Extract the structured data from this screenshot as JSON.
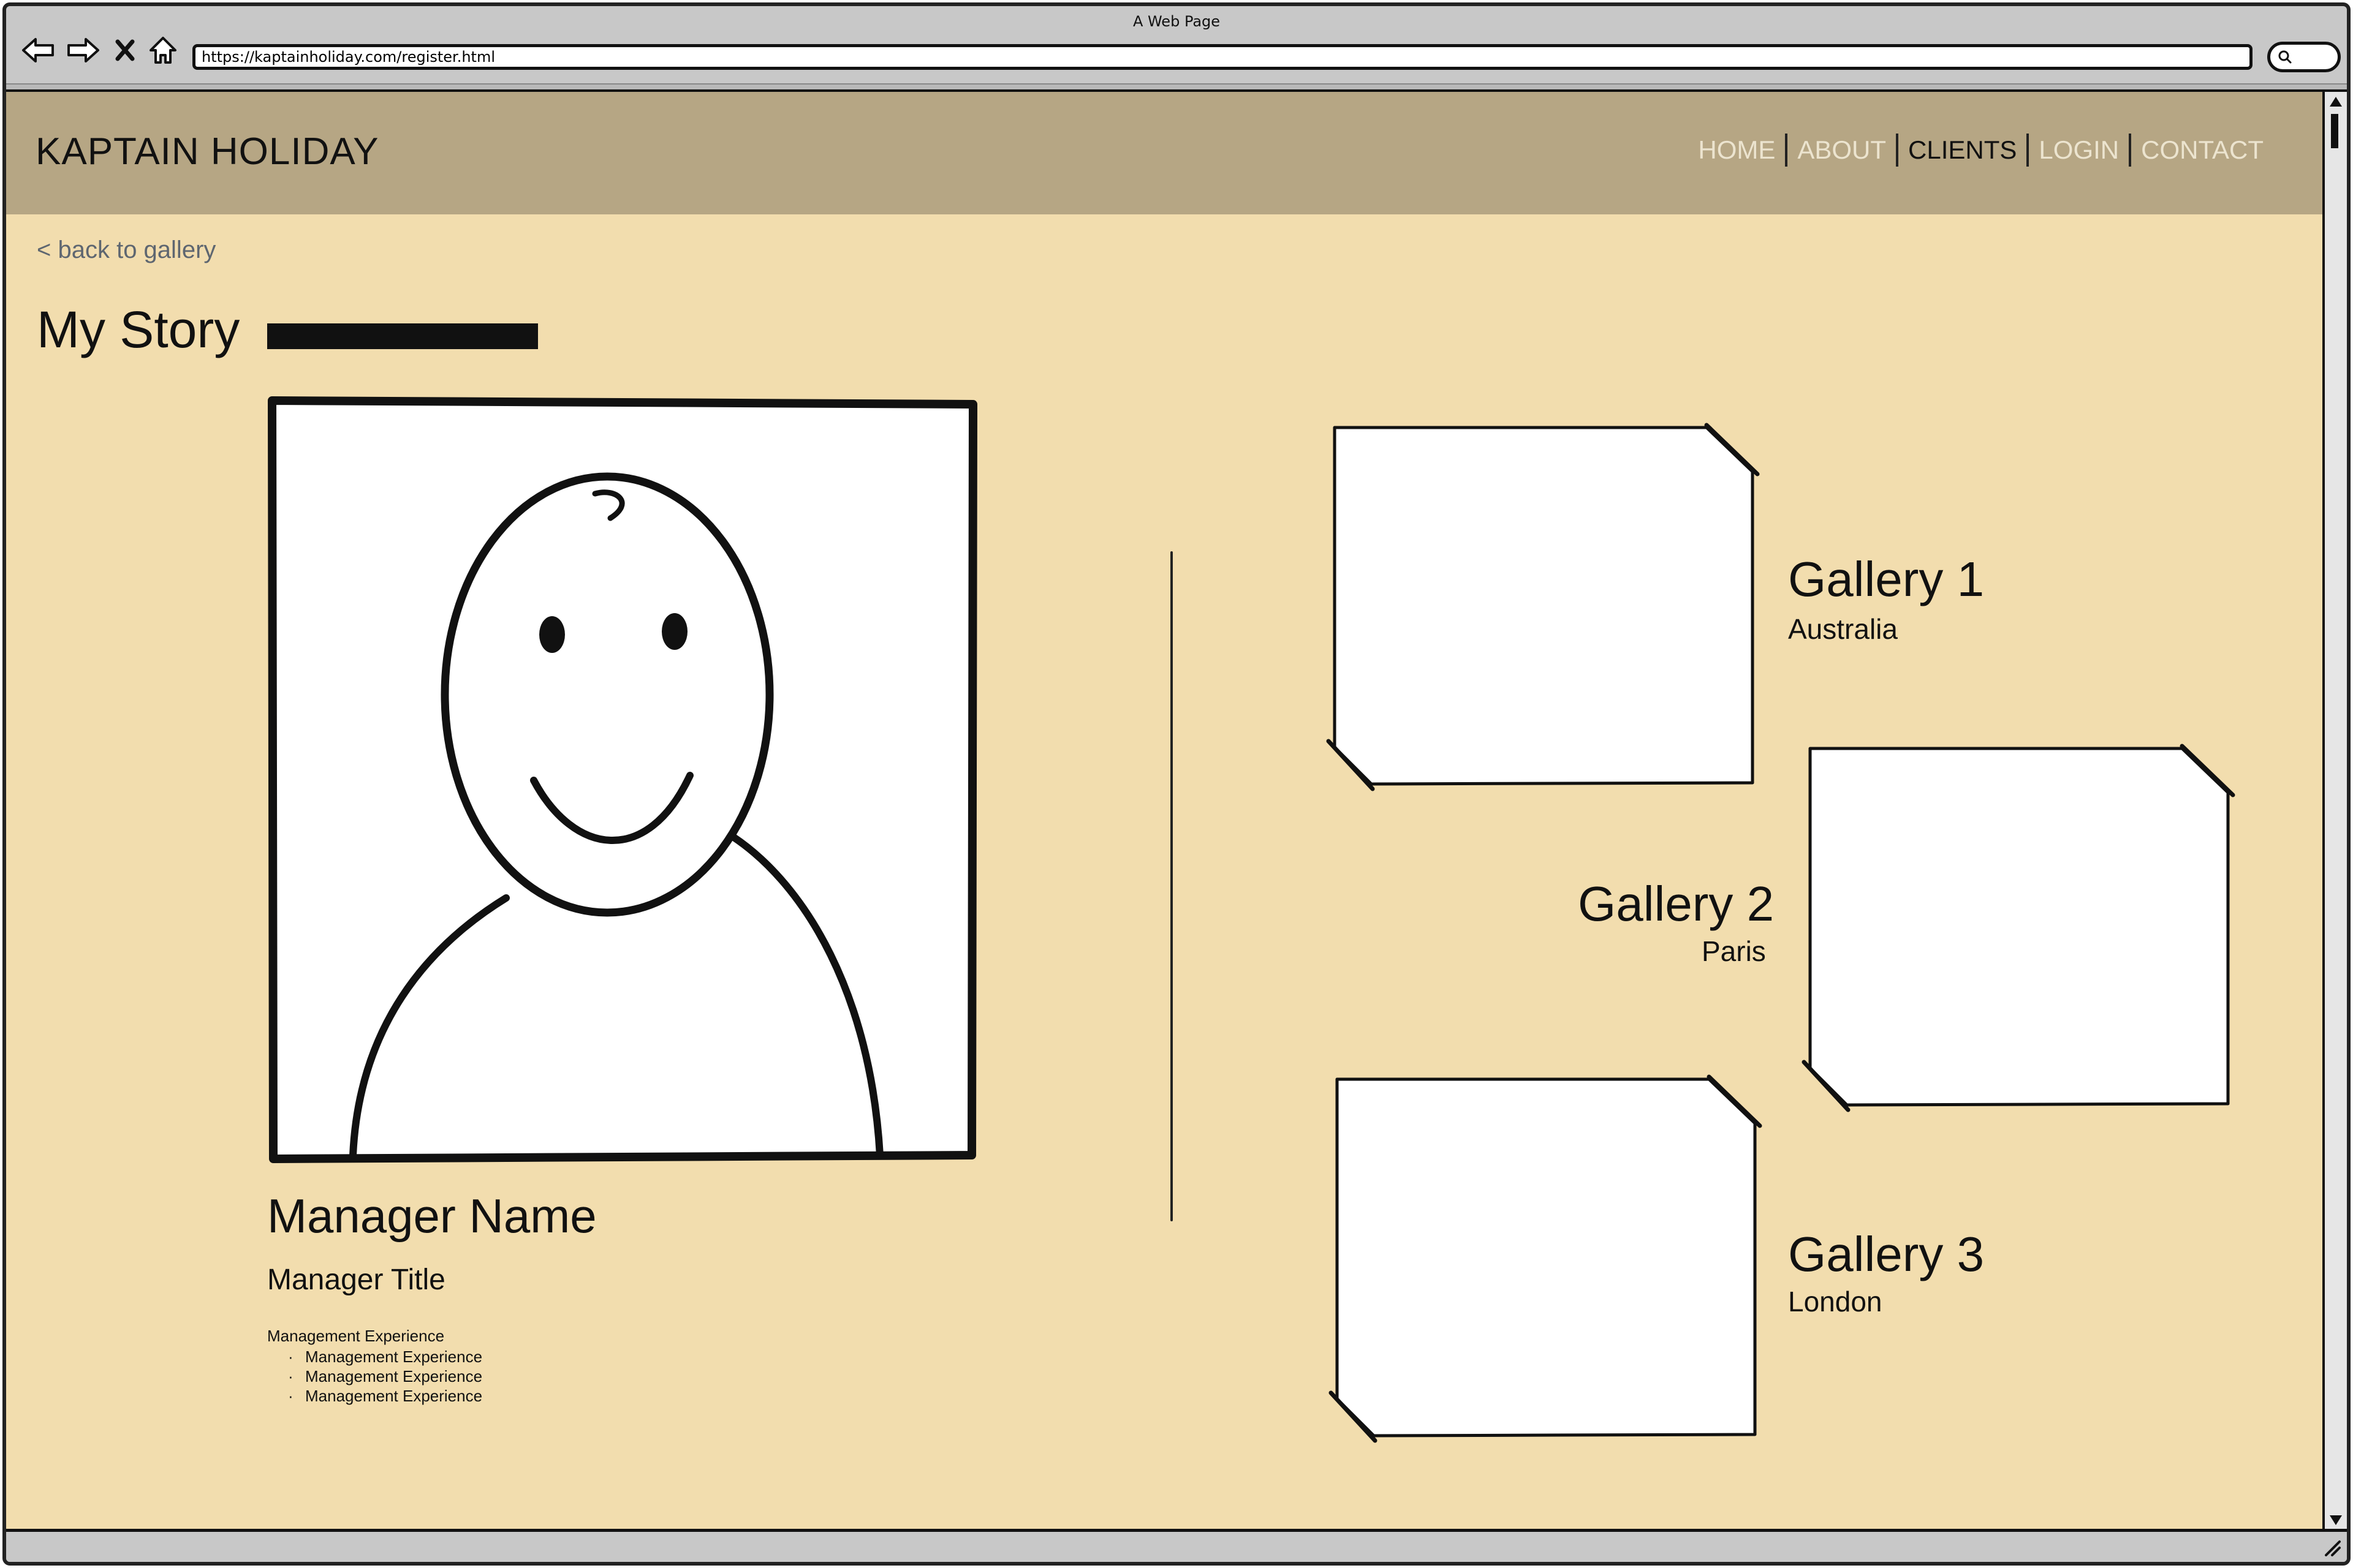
{
  "browser": {
    "window_title": "A Web Page",
    "url": "https://kaptainholiday.com/register.html"
  },
  "header": {
    "logo": "KAPTAIN HOLIDAY",
    "nav": [
      {
        "label": "HOME",
        "active": false
      },
      {
        "label": "ABOUT",
        "active": false
      },
      {
        "label": "CLIENTS",
        "active": true
      },
      {
        "label": "LOGIN",
        "active": false
      },
      {
        "label": "CONTACT",
        "active": false
      }
    ]
  },
  "page": {
    "back_link": "< back to gallery",
    "title": "My Story"
  },
  "manager": {
    "name": "Manager Name",
    "title": "Manager Title",
    "experience_heading": "Management Experience",
    "experience_items": [
      "Management Experience",
      "Management Experience",
      "Management Experience"
    ]
  },
  "galleries": [
    {
      "title": "Gallery 1",
      "subtitle": "Australia"
    },
    {
      "title": "Gallery 2",
      "subtitle": "Paris"
    },
    {
      "title": "Gallery 3",
      "subtitle": "London"
    }
  ],
  "colors": {
    "page_bg": "#f2ddae",
    "header_bg": "#b6a684",
    "nav_inactive": "#ece4cf",
    "nav_active": "#111111",
    "link": "#5e6670"
  },
  "icons": [
    "back-arrow-icon",
    "forward-arrow-icon",
    "stop-icon",
    "home-icon",
    "search-icon",
    "resize-grip-icon"
  ]
}
